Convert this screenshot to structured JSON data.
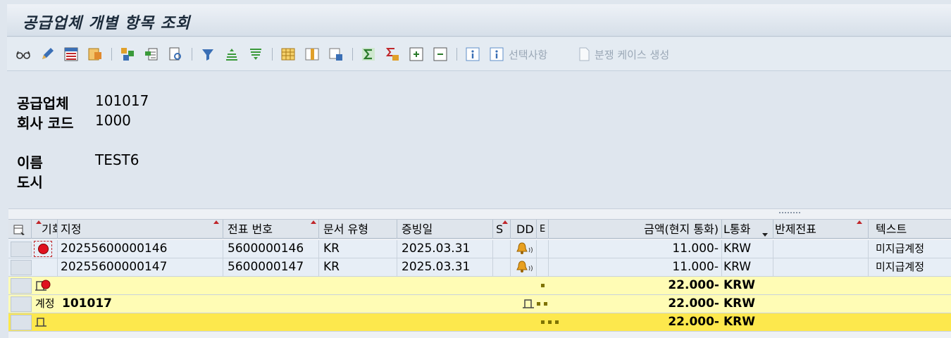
{
  "title": "공급업체 개별 항목 조회",
  "toolbar": {
    "icons": [
      "glasses-icon",
      "pencil-icon",
      "layout-icon",
      "layout-save-icon",
      "doc-tree-icon",
      "doc-copy-icon",
      "doc-search-icon",
      "filter-icon",
      "sort-asc-icon",
      "sort-desc-icon",
      "grid-icon",
      "insert-col-icon",
      "save-layout-icon",
      "sum-icon",
      "subtotal-icon",
      "expand-icon",
      "collapse-icon",
      "info-icon",
      "info-select-icon",
      "doc-icon"
    ],
    "selection_label": "선택사항",
    "dispute_label": "분쟁 케이스 생성"
  },
  "header": {
    "vendor_label": "공급업체",
    "vendor_value": "101017",
    "company_label": "회사 코드",
    "company_value": "1000",
    "name_label": "이름",
    "name_value": "TEST6",
    "city_label": "도시"
  },
  "grid": {
    "columns": {
      "sel": "",
      "status": "기회",
      "assignment": "지정",
      "doc_no": "전표 번호",
      "doc_type": "문서 유형",
      "doc_date": "증빙일",
      "s": "S",
      "dd": "DD",
      "e": "E",
      "amount": "금액(현지 통화)",
      "currency": "L통화",
      "clearing": "반제전표",
      "text": "텍스트"
    },
    "rows": [
      {
        "assignment": "20255600000146",
        "doc_no": "5600000146",
        "doc_type": "KR",
        "doc_date": "2025.03.31",
        "amount": "11.000-",
        "currency": "KRW",
        "text": "미지급계정"
      },
      {
        "assignment": "20255600000147",
        "doc_no": "5600000147",
        "doc_type": "KR",
        "doc_date": "2025.03.31",
        "amount": "11.000-",
        "currency": "KRW",
        "text": "미지급계정"
      }
    ],
    "subtotal": {
      "amount": "22.000-",
      "currency": "KRW"
    },
    "account_total": {
      "label": "계정",
      "account": "101017",
      "amount": "22.000-",
      "currency": "KRW"
    },
    "grand_total": {
      "amount": "22.000-",
      "currency": "KRW"
    },
    "colors": {
      "row_bg": "#e7eef6",
      "subtotal_bg": "#fffcb5",
      "total_bg": "#fde84d",
      "status_red": "#e0101e"
    }
  }
}
